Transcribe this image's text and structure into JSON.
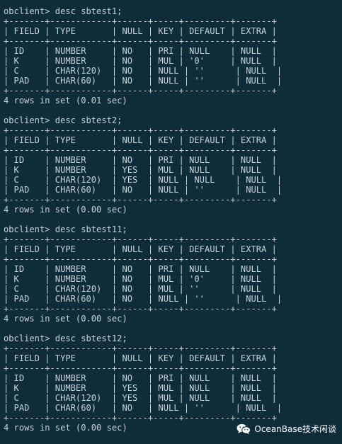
{
  "blocks": [
    {
      "prompt": "obclient> desc sbtest1;",
      "table": [
        "+-------+------------+------+-----+---------+-------+",
        "| FIELD | TYPE       | NULL | KEY | DEFAULT | EXTRA |",
        "+-------+------------+------+-----+---------+-------+",
        "| ID    | NUMBER     | NO   | PRI | NULL    | NULL  |",
        "| K     | NUMBER     | NO   | MUL | '0'     | NULL  |",
        "| C     | CHAR(120)  | NO   | NULL | ''      | NULL  |",
        "| PAD   | CHAR(60)   | NO   | NULL | ''      | NULL  |",
        "+-------+------------+------+-----+---------+-------+"
      ],
      "result": "4 rows in set (0.01 sec)"
    },
    {
      "prompt": "obclient> desc sbtest2;",
      "table": [
        "+-------+------------+------+-----+---------+-------+",
        "| FIELD | TYPE       | NULL | KEY | DEFAULT | EXTRA |",
        "+-------+------------+------+-----+---------+-------+",
        "| ID    | NUMBER     | NO   | PRI | NULL    | NULL  |",
        "| K     | NUMBER     | YES  | MUL | NULL    | NULL  |",
        "| C     | CHAR(120)  | YES  | NULL | NULL    | NULL  |",
        "| PAD   | CHAR(60)   | NO   | NULL | ''      | NULL  |",
        "+-------+------------+------+-----+---------+-------+"
      ],
      "result": "4 rows in set (0.00 sec)"
    },
    {
      "prompt": "obclient> desc sbtest11;",
      "table": [
        "+-------+------------+------+-----+---------+-------+",
        "| FIELD | TYPE       | NULL | KEY | DEFAULT | EXTRA |",
        "+-------+------------+------+-----+---------+-------+",
        "| ID    | NUMBER     | NO   | PRI | NULL    | NULL  |",
        "| K     | NUMBER     | NO   | MUL | '0'     | NULL  |",
        "| C     | CHAR(120)  | NO   | MUL | ''      | NULL  |",
        "| PAD   | CHAR(60)   | NO   | NULL | ''      | NULL  |",
        "+-------+------------+------+-----+---------+-------+"
      ],
      "result": "4 rows in set (0.00 sec)"
    },
    {
      "prompt": "obclient> desc sbtest12;",
      "table": [
        "+-------+------------+------+-----+---------+-------+",
        "| FIELD | TYPE       | NULL | KEY | DEFAULT | EXTRA |",
        "+-------+------------+------+-----+---------+-------+",
        "| ID    | NUMBER     | NO   | PRI | NULL    | NULL  |",
        "| K     | NUMBER     | YES  | MUL | NULL    | NULL  |",
        "| C     | CHAR(120)  | YES  | MUL | NULL    | NULL  |",
        "| PAD   | CHAR(60)   | NO   | NULL | ''      | NULL  |",
        "+-------+------------+------+-----+---------+-------+"
      ],
      "result": "4 rows in set (0.00 sec)"
    }
  ],
  "watermark": {
    "text": "OceanBase技术闲谈",
    "icon": "wechat-icon"
  },
  "colors": {
    "background": "#0e2c3a",
    "text": "#c8d2d8"
  }
}
